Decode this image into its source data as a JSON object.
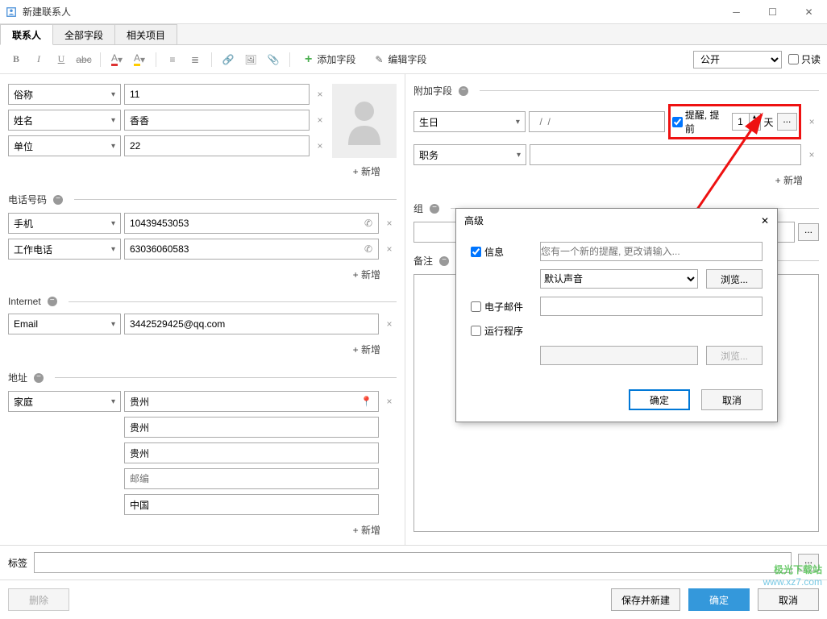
{
  "window": {
    "title": "新建联系人"
  },
  "tabs": {
    "contact": "联系人",
    "all_fields": "全部字段",
    "related": "相关项目"
  },
  "toolbar": {
    "add_field": "添加字段",
    "edit_field": "编辑字段",
    "visibility": "公开",
    "readonly": "只读"
  },
  "name_section": {
    "nickname_label": "俗称",
    "nickname_value": "11",
    "name_label": "姓名",
    "name_value": "香香",
    "company_label": "单位",
    "company_value": "22",
    "add": "新增"
  },
  "phone": {
    "header": "电话号码",
    "mobile_label": "手机",
    "mobile_value": "10439453053",
    "work_label": "工作电话",
    "work_value": "63036060583",
    "add": "新增"
  },
  "internet": {
    "header": "Internet",
    "email_label": "Email",
    "email_value": "3442529425@qq.com",
    "add": "新增"
  },
  "address": {
    "header": "地址",
    "home_label": "家庭",
    "line1": "贵州",
    "line2": "贵州",
    "line3": "贵州",
    "postal_placeholder": "邮编",
    "country": "中国",
    "add": "新增"
  },
  "extra": {
    "header": "附加字段",
    "birthday_label": "生日",
    "date_placeholder": "  /  /",
    "remind_label": "提醒, 提前",
    "remind_days": "1",
    "days_unit": "天",
    "ellipsis": "...",
    "job_label": "职务",
    "add": "新增"
  },
  "group": {
    "header": "组",
    "ellipsis": "..."
  },
  "notes": {
    "header": "备注"
  },
  "dialog": {
    "title": "高级",
    "info": "信息",
    "info_placeholder": "您有一个新的提醒, 更改请输入...",
    "sound": "默认声音",
    "browse": "浏览...",
    "email": "电子邮件",
    "run": "运行程序",
    "ok": "确定",
    "cancel": "取消"
  },
  "tags": {
    "label": "标签",
    "ellipsis": "..."
  },
  "footer": {
    "delete": "删除",
    "save_new": "保存并新建",
    "ok": "确定",
    "cancel": "取消"
  },
  "watermark": {
    "top": "极光下载站",
    "url": "www.xz7.com"
  }
}
